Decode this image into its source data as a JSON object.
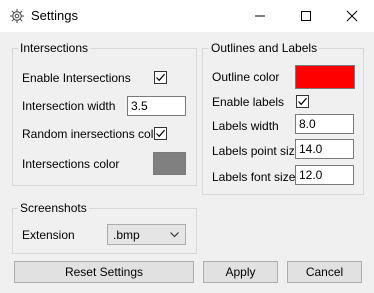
{
  "window": {
    "title": "Settings"
  },
  "intersections": {
    "group_title": "Intersections",
    "enable_label": "Enable Intersections",
    "enable_checked": true,
    "width_label": "Intersection width",
    "width_value": "3.5",
    "random_color_label": "Random inersections color",
    "random_color_checked": true,
    "color_label": "Intersections color",
    "color_value": "#808080"
  },
  "screenshots": {
    "group_title": "Screenshots",
    "extension_label": "Extension",
    "extension_value": ".bmp"
  },
  "outlines": {
    "group_title": "Outlines and Labels",
    "outline_color_label": "Outline color",
    "outline_color_value": "#ff0000",
    "enable_labels_label": "Enable labels",
    "enable_labels_checked": true,
    "labels_width_label": "Labels width",
    "labels_width_value": "8.0",
    "labels_point_size_label": "Labels point size",
    "labels_point_size_value": "14.0",
    "labels_font_size_label": "Labels font size",
    "labels_font_size_value": "12.0"
  },
  "buttons": {
    "reset": "Reset Settings",
    "apply": "Apply",
    "cancel": "Cancel"
  }
}
